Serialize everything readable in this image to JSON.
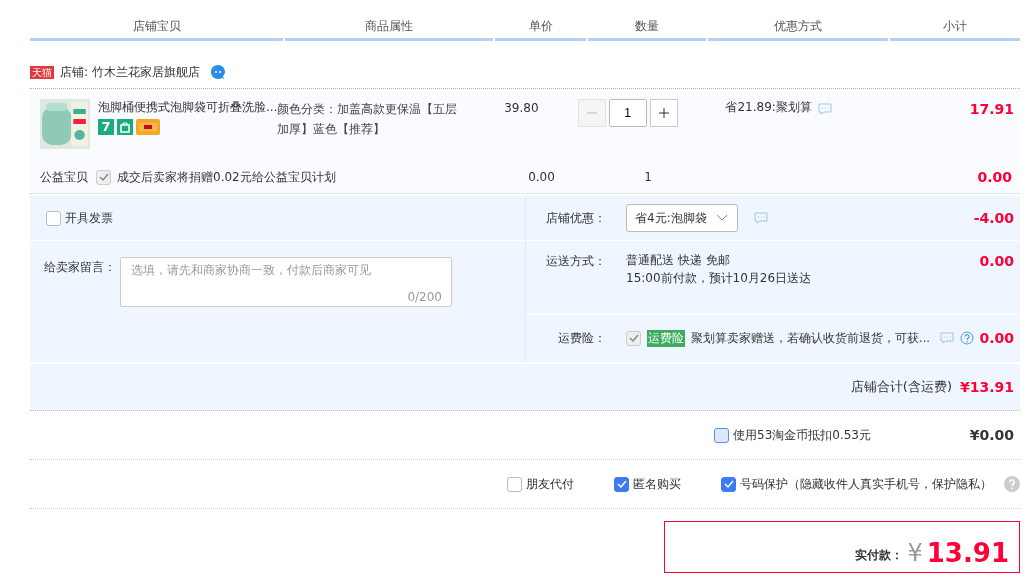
{
  "header": {
    "columns": [
      "店铺宝贝",
      "商品属性",
      "单价",
      "数量",
      "优惠方式",
      "小计"
    ]
  },
  "store": {
    "badge": "天猫",
    "label": "店铺: 竹木兰花家居旗舰店"
  },
  "item": {
    "title": "泡脚桶便携式泡脚袋可折叠洗脸...",
    "badge": "7",
    "attributes": "颜色分类：加盖高款更保温【五层加厚】蓝色【推荐】",
    "price": "39.80",
    "quantity": "1",
    "promotion": "省21.89:聚划算",
    "subtotal": "17.91"
  },
  "charity": {
    "label": "公益宝贝",
    "checked": true,
    "text": "成交后卖家将捐赠0.02元给公益宝贝计划",
    "price": "0.00",
    "quantity": "1",
    "subtotal": "0.00"
  },
  "invoice": {
    "label": "开具发票",
    "checked": false
  },
  "message": {
    "label": "给卖家留言：",
    "placeholder": "选填，请先和商家协商一致，付款后商家可见",
    "counter": "0/200"
  },
  "discount": {
    "label": "店铺优惠：",
    "value": "省4元:泡脚袋",
    "amount": "-4.00"
  },
  "shipping": {
    "label": "运送方式：",
    "lines": [
      "普通配送 快递 免邮",
      "15:00前付款，预计10月26日送达"
    ],
    "amount": "0.00"
  },
  "insurance": {
    "label": "运费险：",
    "checked": true,
    "tag": "运费险",
    "text": "聚划算卖家赠送，若确认收货前退货，可获...",
    "amount": "0.00"
  },
  "store_total": {
    "label": "店铺合计(含运费)",
    "amount": "¥13.91"
  },
  "coins": {
    "label": "使用53淘金币抵扣0.53元",
    "checked": false,
    "amount": "¥0.00"
  },
  "options": [
    {
      "label": "朋友代付",
      "checked": false
    },
    {
      "label": "匿名购买",
      "checked": true
    },
    {
      "label": "号码保护（隐藏收件人真实手机号，保护隐私）",
      "checked": true
    }
  ],
  "payment": {
    "label": "实付款：",
    "currency": "¥",
    "amount": "13.91"
  }
}
